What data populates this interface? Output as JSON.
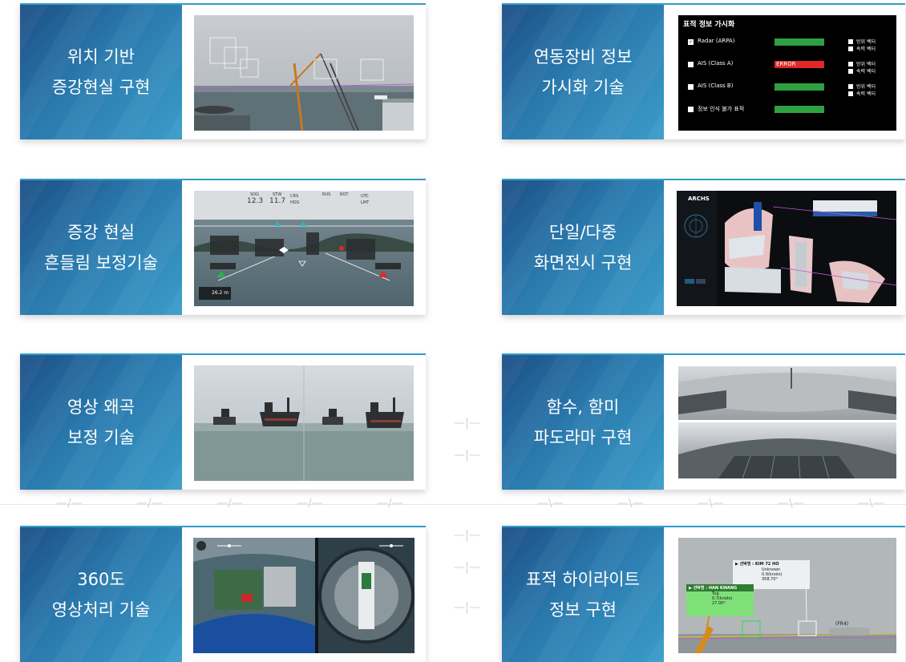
{
  "cards": [
    {
      "line1": "위치 기반",
      "line2": "증강현실 구현",
      "image": "harbor-ar-image"
    },
    {
      "line1": "연동장비 정보",
      "line2": "가시화 기술",
      "image": "target-info-panel"
    },
    {
      "line1": "증강 현실",
      "line2": "흔들림 보정기술",
      "image": "stabilization-hud-image"
    },
    {
      "line1": "단일/다중",
      "line2": "화면전시 구현",
      "image": "multi-screen-image"
    },
    {
      "line1": "영상 왜곡",
      "line2": "보정 기술",
      "image": "distortion-correction-image"
    },
    {
      "line1": "함수, 함미",
      "line2": "파도라마 구현",
      "image": "panorama-image"
    },
    {
      "line1": "360도",
      "line2": "영상처리 기술",
      "image": "fisheye-image"
    },
    {
      "line1": "표적 하이라이트",
      "line2": "정보 구현",
      "image": "target-highlight-image"
    }
  ],
  "panel": {
    "title": "표적 정보 가시화",
    "rows": [
      {
        "label": "Radar (ARPA)",
        "status": "",
        "opt1": "방위 벡터",
        "opt2": "속력 벡터",
        "checked": true
      },
      {
        "label": "AIS (Class A)",
        "status": "ERROR",
        "opt1": "방위 벡터",
        "opt2": "속력 벡터",
        "checked": true
      },
      {
        "label": "AIS (Class B)",
        "status": "",
        "opt1": "방위 벡터",
        "opt2": "속력 벡터",
        "checked": true
      },
      {
        "label": "정보 인식 불가 표적",
        "status": "",
        "opt1": "",
        "opt2": "",
        "checked": false
      }
    ]
  },
  "hud": {
    "sog_label": "SOG",
    "sog": "12.3",
    "stw_label": "STW",
    "stw": "11.7",
    "crs_label": "CRS",
    "hdg_label": "HDG",
    "rus_label": "RUS",
    "rot_label": "ROT",
    "utc_label": "UTC",
    "lmt_label": "LMT",
    "range": "26.2 m"
  },
  "multi": {
    "brand": "ARCHS"
  },
  "highlight": {
    "title1": "▶ 선박명 : KIM 72 HO",
    "t1r1": "Unknown",
    "t1r2": "0.9(knots)",
    "t1r3": "358.70°",
    "title2": "▶ 선박명 : HAN KWANG",
    "t2r1": "Tug",
    "t2r2": "0.7(knots)",
    "t2r3": "27.00°",
    "tag": "(FR4)"
  }
}
